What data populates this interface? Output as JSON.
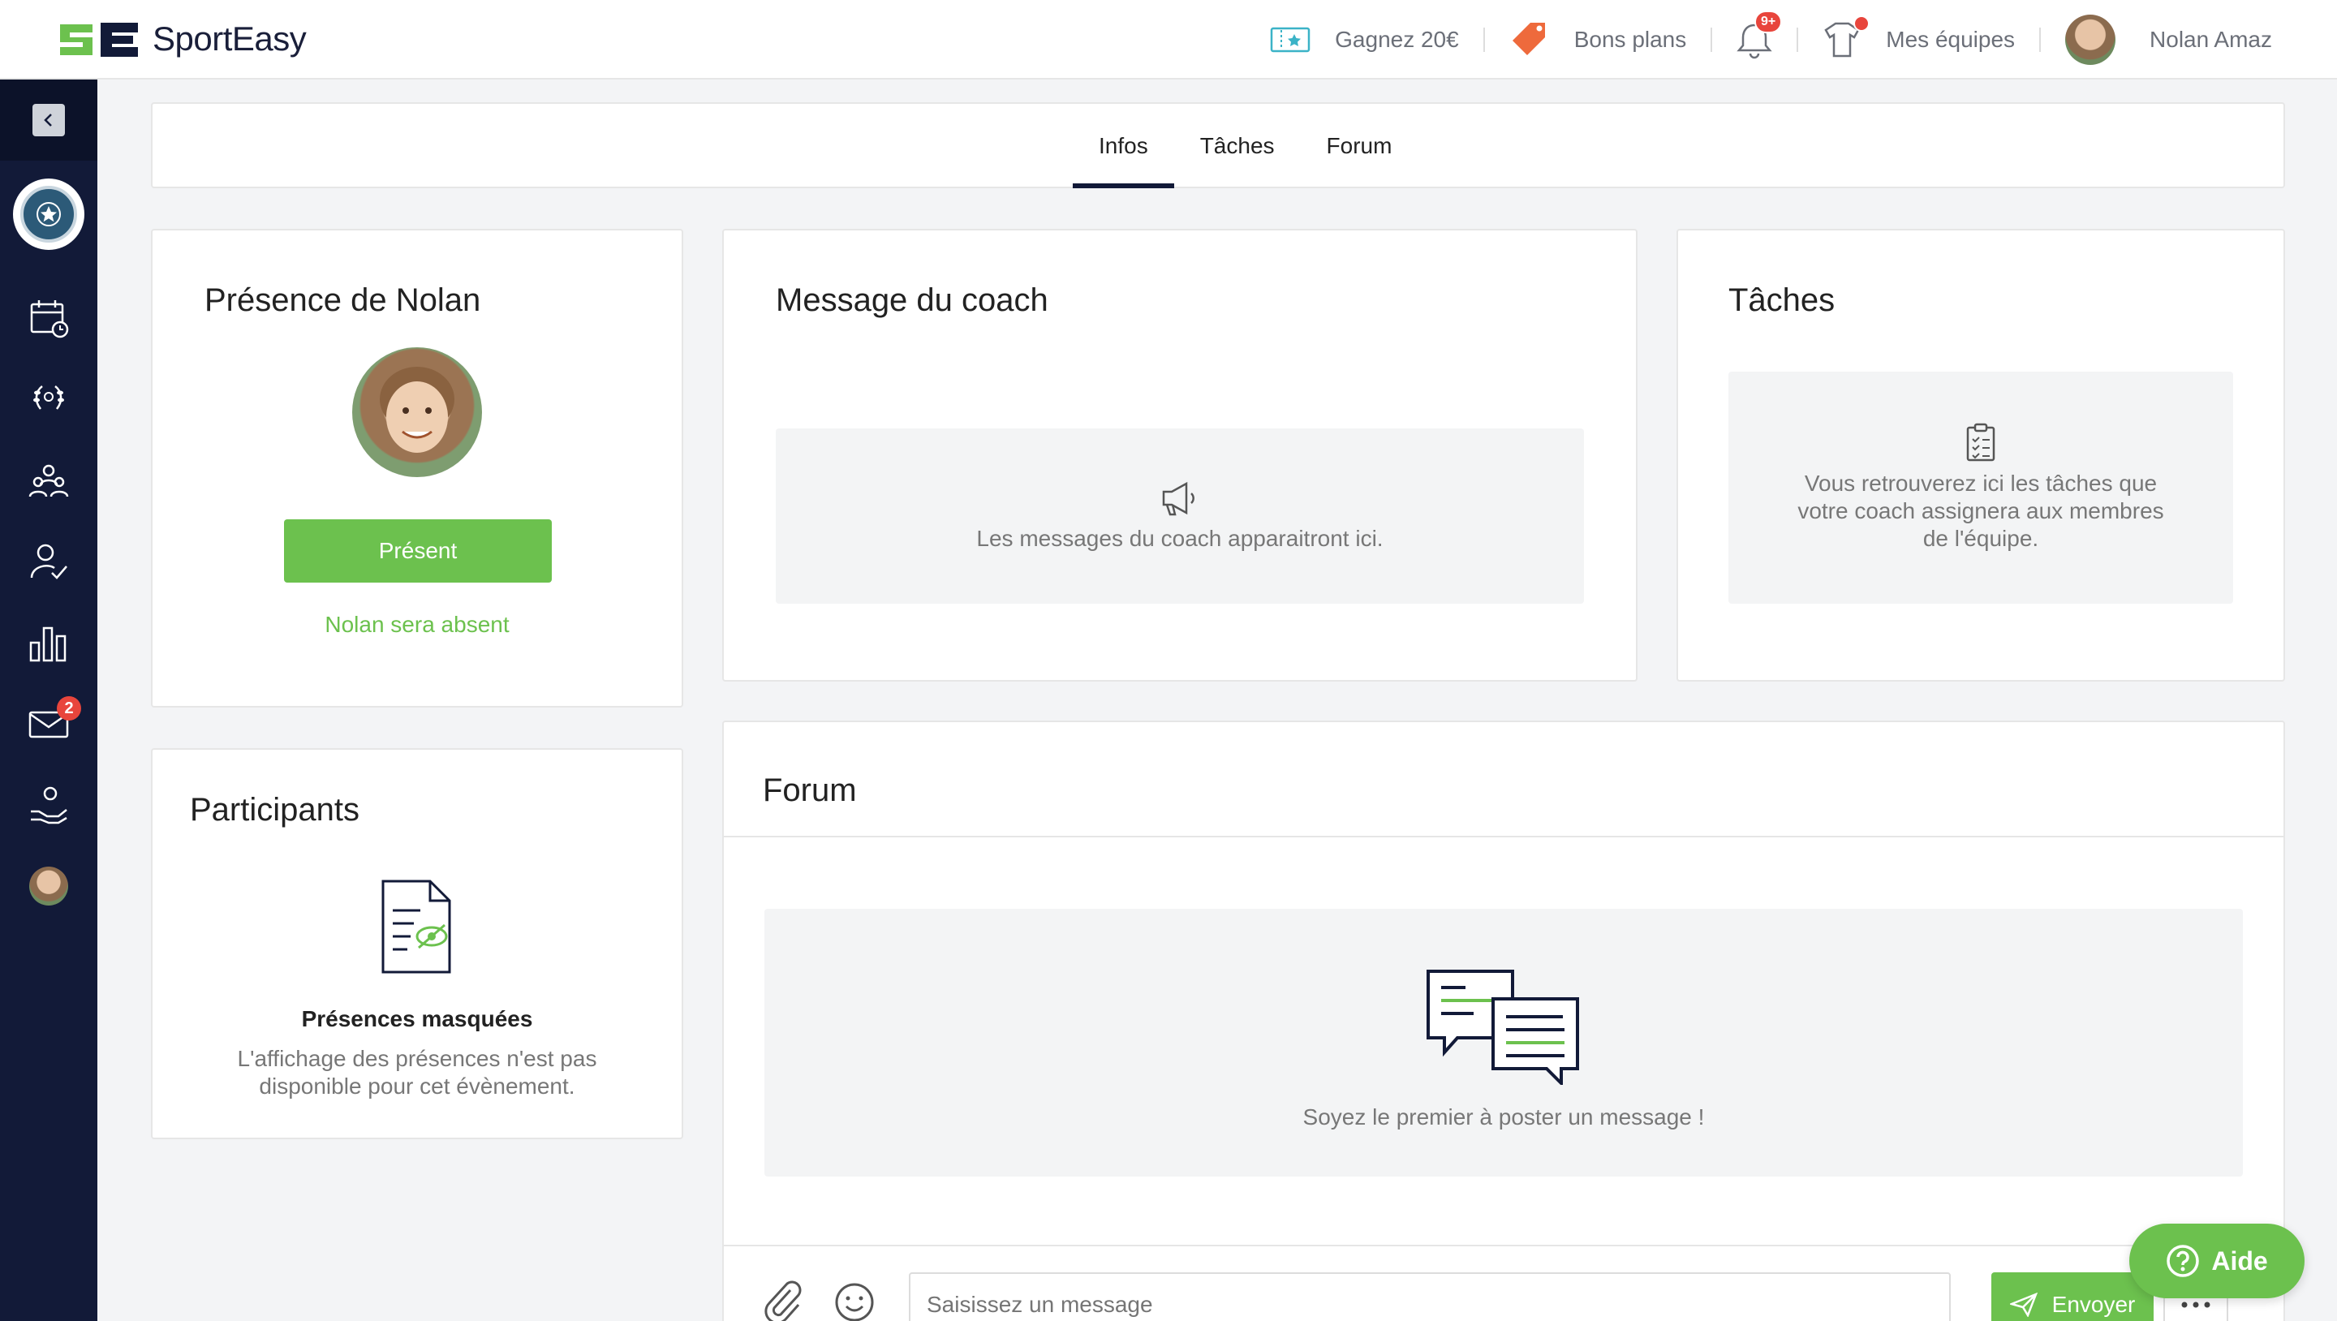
{
  "app": {
    "name": "SportEasy"
  },
  "topnav": {
    "referral": "Gagnez 20€",
    "deals": "Bons plans",
    "notifications_badge": "9+",
    "teams": "Mes équipes",
    "user_name": "Nolan Amaz"
  },
  "sidebar": {
    "messages_badge": "2"
  },
  "tabs": [
    {
      "label": "Infos",
      "active": true
    },
    {
      "label": "Tâches",
      "active": false
    },
    {
      "label": "Forum",
      "active": false
    }
  ],
  "presence": {
    "title": "Présence de Nolan",
    "present_button": "Présent",
    "absent_link": "Nolan sera absent"
  },
  "coach": {
    "title": "Message du coach",
    "empty_text": "Les messages du coach apparaitront ici."
  },
  "tasks": {
    "title": "Tâches",
    "empty_text": "Vous retrouverez ici les tâches que votre coach assignera aux membres de l'équipe."
  },
  "participants": {
    "title": "Participants",
    "hidden_title": "Présences masquées",
    "hidden_desc": "L'affichage des présences n'est pas disponible pour cet évènement."
  },
  "forum": {
    "title": "Forum",
    "empty_text": "Soyez le premier à poster un message !",
    "input_placeholder": "Saisissez un message",
    "send_button": "Envoyer"
  },
  "help": {
    "label": "Aide"
  },
  "colors": {
    "brand_green": "#6cc14e",
    "sidebar_navy": "#121a38",
    "alert_red": "#e8453c"
  }
}
